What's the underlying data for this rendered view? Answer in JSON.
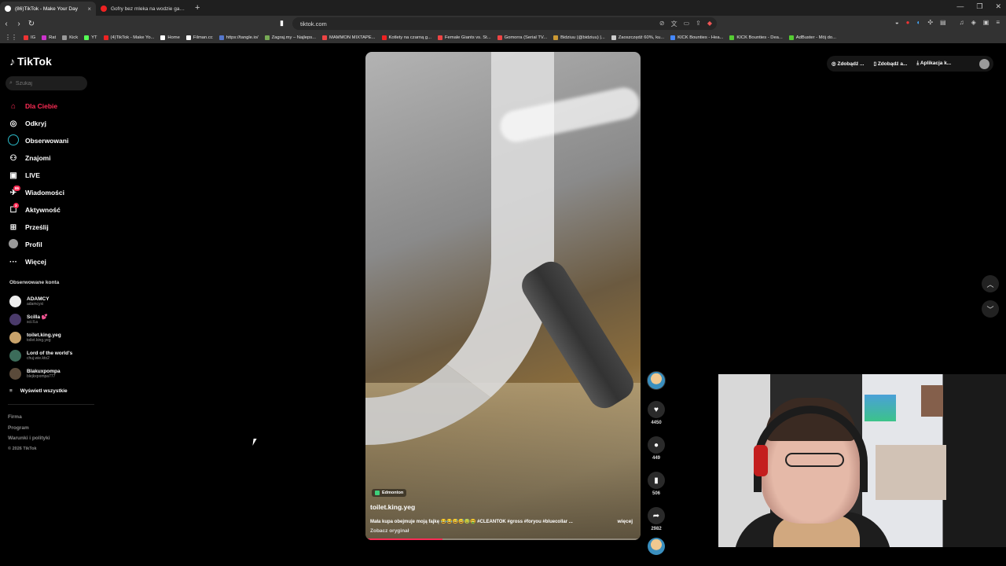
{
  "browser": {
    "tabs": [
      {
        "title": "(86)TikTok - Make Your Day",
        "close": "×"
      },
      {
        "title": "Gofry bez mleka na wodzie gazowanej",
        "close": ""
      }
    ],
    "new_tab": "+",
    "window_controls": [
      "—",
      "❐",
      "✕"
    ],
    "url": "tiktok.com",
    "bookmarks": [
      "IG",
      "Rat",
      "Kick",
      "YT",
      "(4)TikTok - Make Yo...",
      "Home",
      "Filman.cc",
      "https://tangle.io/",
      "Zagraj.my – Najleps...",
      "MAMMON MIXTAPE...",
      "Kotlety na czarną g...",
      "Female Giants vs. St...",
      "Gomorra (Serial TV...",
      "Bidziuu (@bidziuu) |...",
      "Zaoszczędź 60%, ku...",
      "KICK Bounties - Hea...",
      "KICK Bounties - Dea...",
      "AdBuster - Mój do..."
    ]
  },
  "sidebar": {
    "logo": "TikTok",
    "search_placeholder": "Szukaj",
    "menu": [
      {
        "label": "Dla Ciebie",
        "icon": "home-icon",
        "glyph": "⌂"
      },
      {
        "label": "Odkryj",
        "icon": "compass-icon",
        "glyph": "◎"
      },
      {
        "label": "Obserwowani",
        "icon": "following-icon",
        "glyph": ""
      },
      {
        "label": "Znajomi",
        "icon": "friends-icon",
        "glyph": "👥"
      },
      {
        "label": "LIVE",
        "icon": "live-icon",
        "glyph": "▣"
      },
      {
        "label": "Wiadomości",
        "icon": "messages-icon",
        "glyph": "✉",
        "badge": "86"
      },
      {
        "label": "Aktywność",
        "icon": "activity-icon",
        "glyph": "☐",
        "badge": "3"
      },
      {
        "label": "Prześlij",
        "icon": "upload-icon",
        "glyph": "⊞"
      },
      {
        "label": "Profil",
        "icon": "profile-icon",
        "glyph": "●"
      },
      {
        "label": "Więcej",
        "icon": "more-icon",
        "glyph": "···"
      }
    ],
    "followed_title": "Obserwowane konta",
    "accounts": [
      {
        "name": "ADAMCY",
        "handle": "adamcyxi"
      },
      {
        "name": "Scilla 💕",
        "handle": "sci.ll.a"
      },
      {
        "name": "toilet.king.yeg",
        "handle": "toilet.king.yeg"
      },
      {
        "name": "Lord of the world's",
        "handle": "chuj.wie.kto2"
      },
      {
        "name": "Blakuxpompa",
        "handle": "blejkxpompa777"
      }
    ],
    "show_all": "Wyświetl wszystkie",
    "footer": [
      "Firma",
      "Program",
      "Warunki i polityki"
    ],
    "copyright": "© 2026 TikTok"
  },
  "top_right": {
    "btn1": "Zdobądź ...",
    "btn2": "Zdobądź a...",
    "btn3": "Aplikacja k..."
  },
  "video": {
    "location": "Edmonton",
    "author": "toilet.king.yeg",
    "caption": "Mała kupa obejmuje moją fajkę 😂😂😅😅🤢🤮 #CLEANTOK #gross #foryou #bluecollar ...",
    "more": "więcej",
    "original": "Zobacz oryginał",
    "progress": 0.28
  },
  "actions": {
    "likes": "4450",
    "comments": "449",
    "saves": "506",
    "shares": "2982"
  },
  "colors": {
    "accent": "#fe2c55",
    "background": "#000000"
  }
}
